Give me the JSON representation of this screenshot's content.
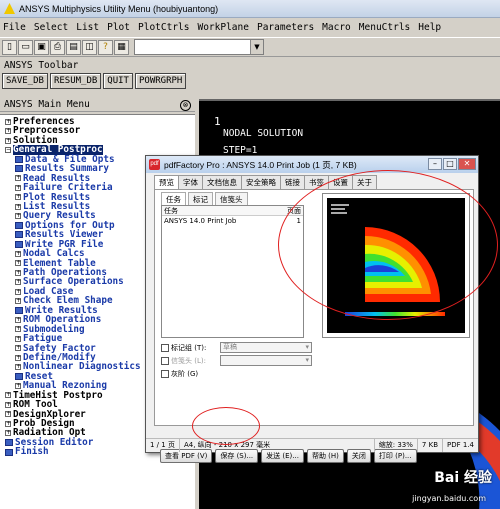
{
  "window": {
    "title": "ANSYS Multiphysics Utility Menu (houbiyuantong)"
  },
  "menubar": [
    "File",
    "Select",
    "List",
    "Plot",
    "PlotCtrls",
    "WorkPlane",
    "Parameters",
    "Macro",
    "MenuCtrls",
    "Help"
  ],
  "icon_toolbar": {
    "icons": [
      "new-file-icon",
      "open-folder-icon",
      "save-icon",
      "print-icon",
      "report-icon",
      "image-capture-icon",
      "help-icon",
      "pan-icon"
    ]
  },
  "ansys_toolbar": {
    "label": "ANSYS Toolbar",
    "buttons": [
      "SAVE_DB",
      "RESUM_DB",
      "QUIT",
      "POWRGRPH"
    ]
  },
  "main_menu": {
    "title": "ANSYS Main Menu",
    "collapse_symbol": "⊗",
    "items": [
      {
        "label": "Preferences",
        "level": 0,
        "sign": "+",
        "style": ""
      },
      {
        "label": "Preprocessor",
        "level": 0,
        "sign": "+",
        "style": ""
      },
      {
        "label": "Solution",
        "level": 0,
        "sign": "+",
        "style": ""
      },
      {
        "label": "General Postproc",
        "level": 0,
        "sign": "-",
        "style": "selected"
      },
      {
        "label": "Data & File Opts",
        "level": 1,
        "sign": "",
        "style": "blue-icon"
      },
      {
        "label": "Results Summary",
        "level": 1,
        "sign": "",
        "style": "blue-icon"
      },
      {
        "label": "Read Results",
        "level": 1,
        "sign": "+",
        "style": ""
      },
      {
        "label": "Failure Criteria",
        "level": 1,
        "sign": "+",
        "style": ""
      },
      {
        "label": "Plot Results",
        "level": 1,
        "sign": "+",
        "style": ""
      },
      {
        "label": "List Results",
        "level": 1,
        "sign": "+",
        "style": ""
      },
      {
        "label": "Query Results",
        "level": 1,
        "sign": "+",
        "style": ""
      },
      {
        "label": "Options for Outp",
        "level": 1,
        "sign": "",
        "style": "blue-icon"
      },
      {
        "label": "Results Viewer",
        "level": 1,
        "sign": "",
        "style": "blue-icon"
      },
      {
        "label": "Write PGR File",
        "level": 1,
        "sign": "",
        "style": "blue-icon"
      },
      {
        "label": "Nodal Calcs",
        "level": 1,
        "sign": "+",
        "style": ""
      },
      {
        "label": "Element Table",
        "level": 1,
        "sign": "+",
        "style": ""
      },
      {
        "label": "Path Operations",
        "level": 1,
        "sign": "+",
        "style": ""
      },
      {
        "label": "Surface Operations",
        "level": 1,
        "sign": "+",
        "style": ""
      },
      {
        "label": "Load Case",
        "level": 1,
        "sign": "+",
        "style": ""
      },
      {
        "label": "Check Elem Shape",
        "level": 1,
        "sign": "+",
        "style": ""
      },
      {
        "label": "Write Results",
        "level": 1,
        "sign": "",
        "style": "blue-icon"
      },
      {
        "label": "ROM Operations",
        "level": 1,
        "sign": "+",
        "style": ""
      },
      {
        "label": "Submodeling",
        "level": 1,
        "sign": "+",
        "style": ""
      },
      {
        "label": "Fatigue",
        "level": 1,
        "sign": "+",
        "style": ""
      },
      {
        "label": "Safety Factor",
        "level": 1,
        "sign": "+",
        "style": ""
      },
      {
        "label": "Define/Modify",
        "level": 1,
        "sign": "+",
        "style": ""
      },
      {
        "label": "Nonlinear Diagnostics",
        "level": 1,
        "sign": "+",
        "style": ""
      },
      {
        "label": "Reset",
        "level": 1,
        "sign": "",
        "style": "blue-icon"
      },
      {
        "label": "Manual Rezoning",
        "level": 1,
        "sign": "+",
        "style": ""
      },
      {
        "label": "TimeHist Postpro",
        "level": 0,
        "sign": "+",
        "style": ""
      },
      {
        "label": "ROM Tool",
        "level": 0,
        "sign": "+",
        "style": ""
      },
      {
        "label": "DesignXplorer",
        "level": 0,
        "sign": "+",
        "style": ""
      },
      {
        "label": "Prob Design",
        "level": 0,
        "sign": "+",
        "style": ""
      },
      {
        "label": "Radiation Opt",
        "level": 0,
        "sign": "+",
        "style": ""
      },
      {
        "label": "Session Editor",
        "level": 0,
        "sign": "",
        "style": "blue-icon"
      },
      {
        "label": "Finish",
        "level": 0,
        "sign": "",
        "style": "blue-icon"
      }
    ]
  },
  "graphics": {
    "window_number": "1",
    "line1": "NODAL SOLUTION",
    "line2": "STEP=1"
  },
  "pdf_dialog": {
    "title": "pdfFactory Pro : ANSYS 14.0 Print Job (1 页, 7 KB)",
    "tabs": [
      "预览",
      "字体",
      "文档信息",
      "安全策略",
      "链接",
      "书签",
      "设置",
      "关于"
    ],
    "subtabs": [
      "任务",
      "标记",
      "信笺头"
    ],
    "job_table": {
      "headers": [
        "任务",
        "页面"
      ],
      "rows": [
        [
          "ANSYS 14.0 Print Job",
          "1"
        ]
      ]
    },
    "checkboxes": [
      {
        "label": "标记组 (T):",
        "select_value": "草稿",
        "disabled": false
      },
      {
        "label": "信笺头 (L):",
        "select_value": "",
        "disabled": true
      },
      {
        "label": "灰阶 (G)",
        "select_value": null,
        "disabled": false
      }
    ],
    "buttons": [
      "查看 PDF (V)",
      "保存 (S)...",
      "发送 (E)...",
      "帮助 (H)",
      "关闭",
      "打印 (P)..."
    ],
    "status": {
      "pages": "1 / 1 页",
      "paper": "A4, 纵向 - 210 x 297 毫米",
      "zoom": "缩放: 33%",
      "size": "7 KB",
      "pdf_version": "PDF 1.4"
    }
  },
  "watermark": {
    "text": "Bai 经验",
    "url": "jingyan.baidu.com"
  },
  "colors": {
    "selected": "#0a246a",
    "annotation": "#e02020",
    "menu_blue": "#1a3aa8"
  }
}
